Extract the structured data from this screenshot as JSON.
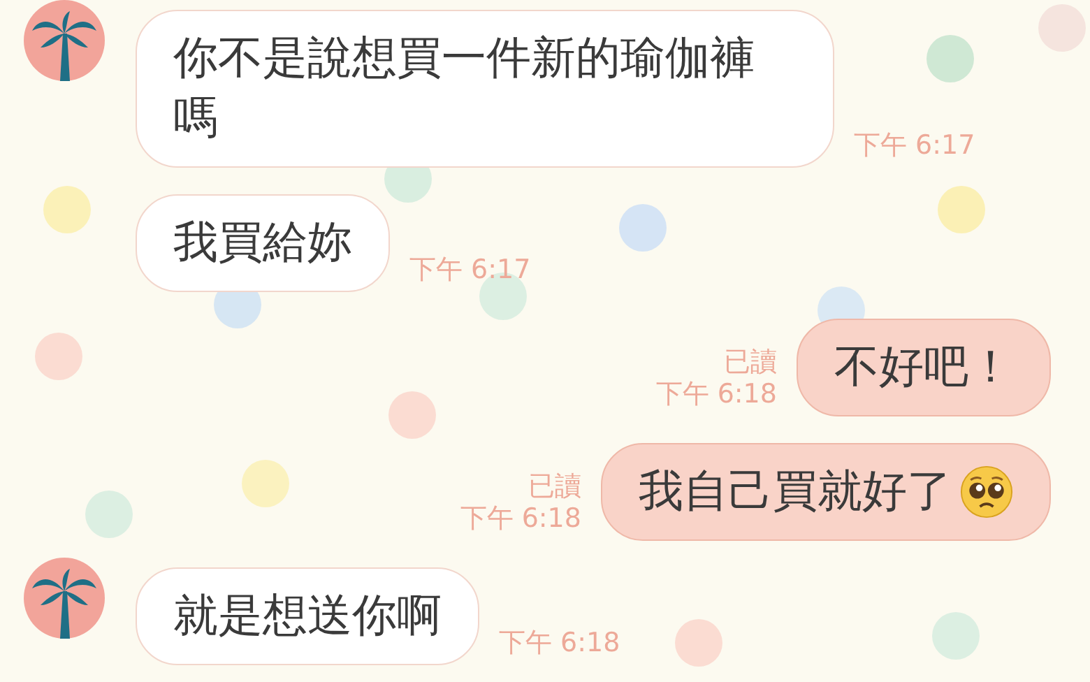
{
  "messages": [
    {
      "kind": "incoming",
      "show_avatar": true,
      "text": "你不是說想買一件新的瑜伽褲嗎",
      "time": "下午 6:17"
    },
    {
      "kind": "incoming",
      "show_avatar": false,
      "text": "我買給妳",
      "time": "下午 6:17"
    },
    {
      "kind": "outgoing",
      "read": "已讀",
      "text": "不好吧！",
      "time": "下午 6:18",
      "emoji": false
    },
    {
      "kind": "outgoing",
      "read": "已讀",
      "text": "我自己買就好了",
      "time": "下午 6:18",
      "emoji": true
    },
    {
      "kind": "incoming",
      "show_avatar": true,
      "text": "就是想送你啊",
      "time": "下午 6:18"
    }
  ]
}
